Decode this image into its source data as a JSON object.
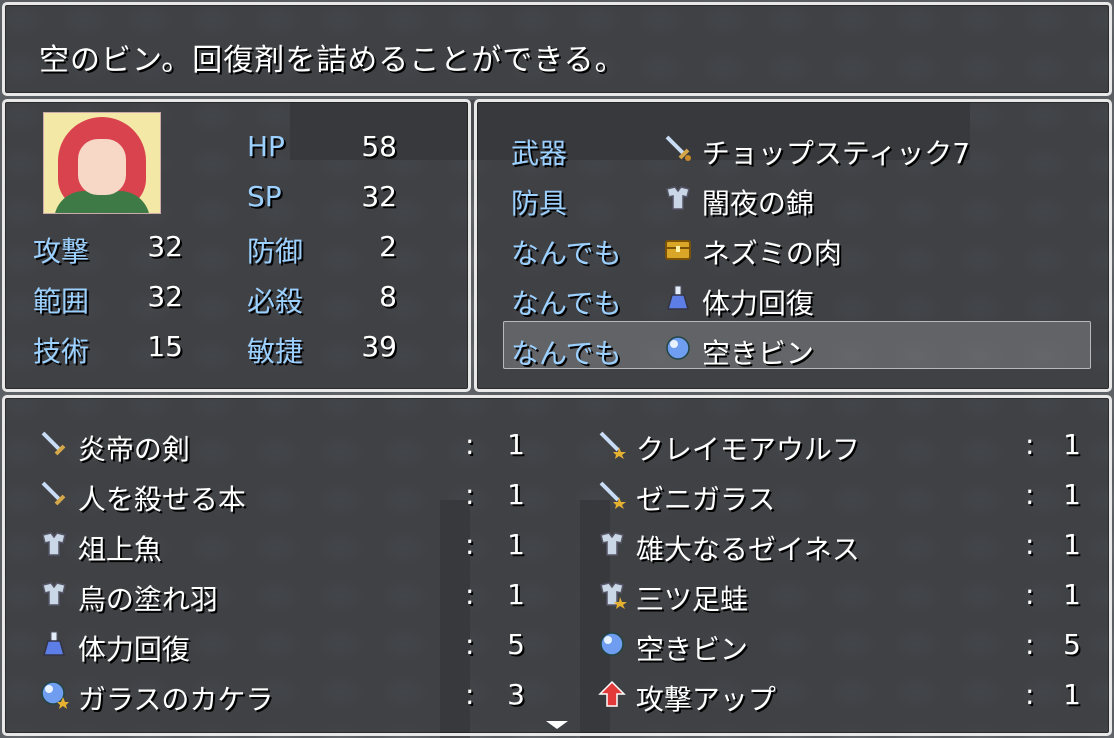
{
  "help": {
    "text": "空のビン。回復剤を詰めることができる。"
  },
  "status": {
    "hp_label": "HP",
    "hp": "58",
    "sp_label": "SP",
    "sp": "32",
    "stats": [
      {
        "l1": "攻撃",
        "v1": "32",
        "l2": "防御",
        "v2": "2"
      },
      {
        "l1": "範囲",
        "v1": "32",
        "l2": "必殺",
        "v2": "8"
      },
      {
        "l1": "技術",
        "v1": "15",
        "l2": "敏捷",
        "v2": "39"
      }
    ]
  },
  "equip": {
    "slots": [
      {
        "slot": "武器",
        "icon": "sword-icon",
        "item": "チョップスティック7"
      },
      {
        "slot": "防具",
        "icon": "armor-icon",
        "item": "闇夜の錦"
      },
      {
        "slot": "なんでも",
        "icon": "treasure-chest-icon",
        "item": "ネズミの肉"
      },
      {
        "slot": "なんでも",
        "icon": "potion-icon",
        "item": "体力回復"
      },
      {
        "slot": "なんでも",
        "icon": "bottle-orb-icon",
        "item": "空きビン"
      }
    ],
    "selected_index": 4
  },
  "items": {
    "list": [
      {
        "icon": "sword-icon",
        "name": "炎帝の剣",
        "sep": ":",
        "count": "1"
      },
      {
        "icon": "sword-star-icon",
        "name": "クレイモアウルフ",
        "sep": ":",
        "count": "1"
      },
      {
        "icon": "sword-icon",
        "name": "人を殺せる本",
        "sep": ":",
        "count": "1"
      },
      {
        "icon": "sword-star-icon",
        "name": "ゼニガラス",
        "sep": ":",
        "count": "1"
      },
      {
        "icon": "armor-icon",
        "name": "俎上魚",
        "sep": ":",
        "count": "1"
      },
      {
        "icon": "armor-icon",
        "name": "雄大なるゼイネス",
        "sep": ":",
        "count": "1"
      },
      {
        "icon": "armor-icon",
        "name": "烏の塗れ羽",
        "sep": ":",
        "count": "1"
      },
      {
        "icon": "armor-star-icon",
        "name": "三ツ足蛙",
        "sep": ":",
        "count": "1"
      },
      {
        "icon": "potion-icon",
        "name": "体力回復",
        "sep": ":",
        "count": "5"
      },
      {
        "icon": "bottle-orb-icon",
        "name": "空きビン",
        "sep": ":",
        "count": "5"
      },
      {
        "icon": "bottle-orb-star-icon",
        "name": "ガラスのカケラ",
        "sep": ":",
        "count": "3"
      },
      {
        "icon": "red-up-arrow-icon",
        "name": "攻撃アップ",
        "sep": ":",
        "count": "1"
      }
    ]
  },
  "colors": {
    "system": "#9bd0ff",
    "window_border": "#e8e8e8"
  }
}
